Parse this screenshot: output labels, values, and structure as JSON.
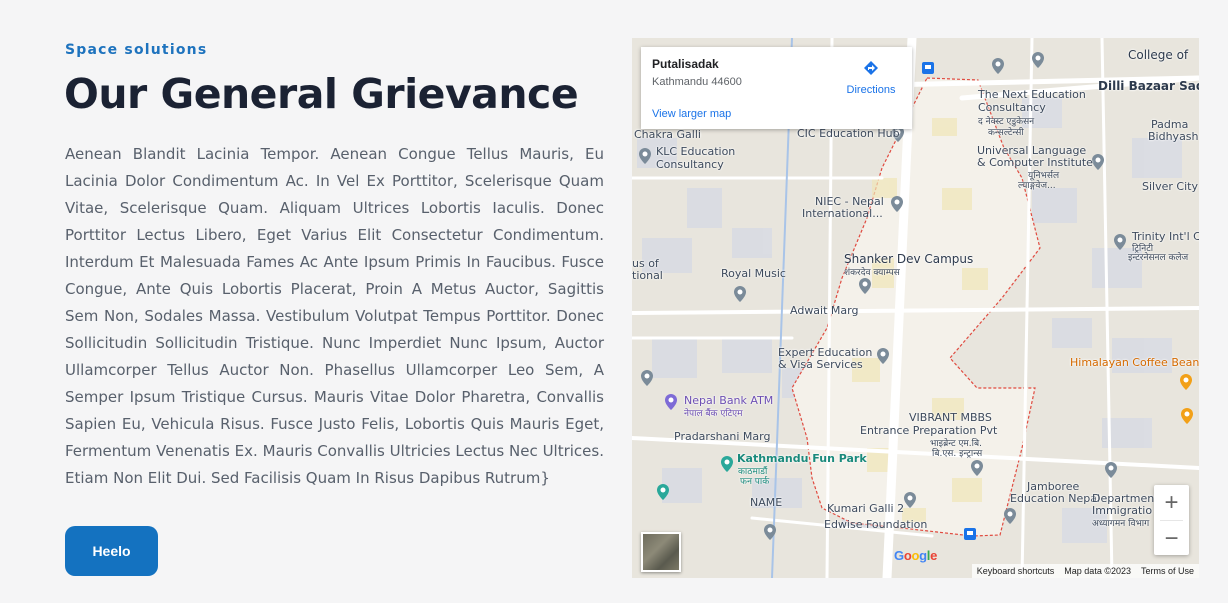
{
  "section": {
    "eyebrow": "Space solutions",
    "title": "Our General Grievance",
    "body": "Aenean Blandit Lacinia Tempor. Aenean Congue Tellus Mauris, Eu Lacinia Dolor Condimentum Ac. In Vel Ex Porttitor, Scelerisque Quam Vitae, Scelerisque Quam. Aliquam Ultrices Lobortis Iaculis. Donec Porttitor Lectus Libero, Eget Varius Elit Consectetur Condimentum. Interdum Et Malesuada Fames Ac Ante Ipsum Primis In Faucibus. Fusce Congue, Ante Quis Lobortis Placerat, Proin A Metus Auctor, Sagittis Sem Non, Sodales Massa. Vestibulum Volutpat Tempus Porttitor. Donec Sollicitudin Sollicitudin Tristique. Nunc Imperdiet Nunc Ipsum, Auctor Ullamcorper Tellus Auctor Non. Phasellus Ullamcorper Leo Sem, A Semper Ipsum Tristique Cursus. Mauris Vitae Dolor Pharetra, Convallis Sapien Eu, Vehicula Risus. Fusce Justo Felis, Lobortis Quis Mauris Eget, Fermentum Venenatis Ex. Mauris Convallis Ultricies Lectus Nec Ultrices. Etiam Non Elit Dui. Sed Facilisis Quam In Risus Dapibus Rutrum}",
    "button_label": "Heelo",
    "accent": "#1472c0"
  },
  "map": {
    "info": {
      "place": "Putalisadak",
      "address": "Kathmandu 44600",
      "larger_map": "View larger map",
      "directions": "Directions"
    },
    "labels": {
      "college": "College of",
      "dilli": "Dilli Bazaar Sadak",
      "padma": "Padma",
      "bidhya": "Bidhyash",
      "next_edu": "The Next Education",
      "consultancy": "Consultancy",
      "next_np1": "द नेक्स्ट एडुकेसन",
      "next_np2": "कन्सल्टेन्सी",
      "chakra": "Chakra Galli",
      "cic": "CIC Education Hub",
      "klc1": "KLC Education",
      "klc2": "Consultancy",
      "universal1": "Universal Language",
      "universal2": "& Computer Institute",
      "universal_np1": "यूनिभर्सल",
      "universal_np2": "ल्याङ्गवेज...",
      "silver": "Silver City",
      "niec1": "NIEC - Nepal",
      "niec2": "International...",
      "trinity1": "Trinity Int'l C",
      "trinity_np1": "ट्रिनिटी",
      "trinity_np2": "इन्टरनेसनल कलेज",
      "shanker": "Shanker Dev Campus",
      "shanker_np": "शंकरदेव क्याम्पस",
      "us_of": "us of",
      "tional": "tional",
      "royal": "Royal Music",
      "adwait": "Adwait Marg",
      "expert1": "Expert Education",
      "expert2": "& Visa Services",
      "himalayan": "Himalayan Coffee Bean",
      "nepal_bank": "Nepal Bank ATM",
      "nepal_bank_np": "नेपाल बैंक एटिएम",
      "vibrant1": "VIBRANT MBBS",
      "vibrant2": "Entrance Preparation Pvt",
      "vibrant_np1": "भाइब्रेन्ट एम.बि.",
      "vibrant_np2": "बि.एस. इन्ट्रान्स",
      "pradarshani": "Pradarshani Marg",
      "fun_park": "Kathmandu Fun Park",
      "fun_park_np1": "काठमाडौं",
      "fun_park_np2": "फन पार्क",
      "jamboree1": "Jamboree",
      "jamboree2": "Education Nepal",
      "department": "Department",
      "immigration": "Immigratio",
      "immigration_np": "अध्यागमन विभाग",
      "name": "NAME",
      "kumari": "Kumari Galli 2",
      "edwise": "Edwise Foundation"
    },
    "google": [
      "G",
      "o",
      "o",
      "g",
      "l",
      "e"
    ],
    "google_colors": [
      "#4285f4",
      "#ea4335",
      "#fbbc05",
      "#4285f4",
      "#34a853",
      "#ea4335"
    ],
    "attribution": {
      "shortcuts": "Keyboard shortcuts",
      "data": "Map data ©2023",
      "terms": "Terms of Use"
    },
    "zoom_in": "+",
    "zoom_out": "−"
  }
}
